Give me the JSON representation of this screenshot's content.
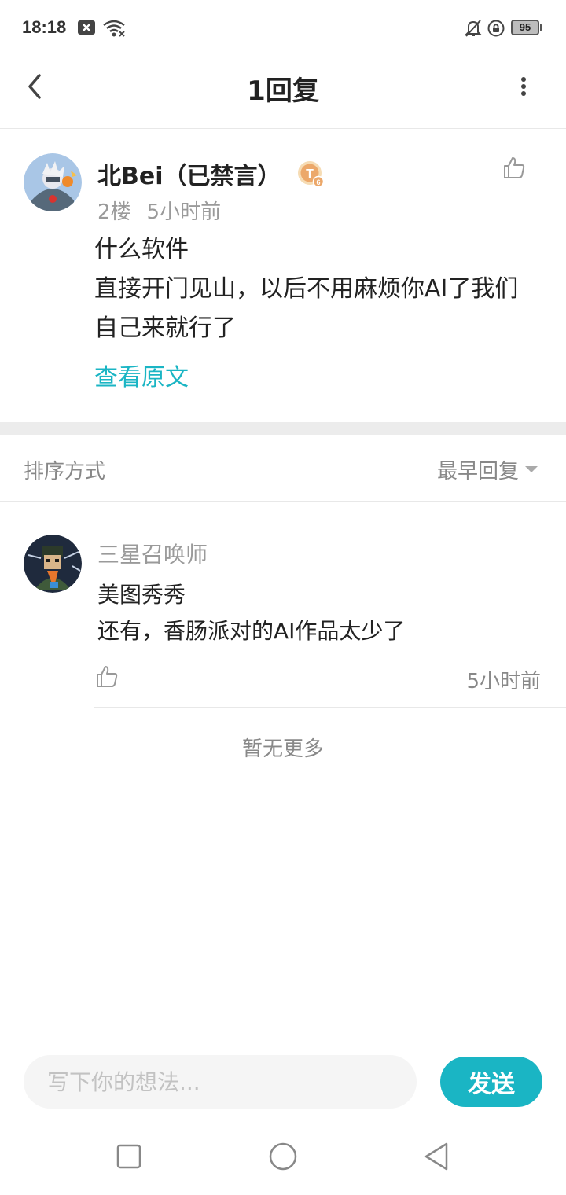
{
  "status_bar": {
    "time": "18:18",
    "battery": "95",
    "icons": [
      "notification-x-icon",
      "wifi-icon",
      "mute-bell-icon",
      "rotation-lock-icon",
      "battery-icon"
    ]
  },
  "nav": {
    "title": "1回复",
    "back_icon": "chevron-left-icon",
    "more_icon": "vertical-ellipsis-icon"
  },
  "post": {
    "author": "北Bei（已禁言）",
    "badge_icon": "level-badge-icon",
    "badge_letter": "T",
    "badge_level": "6",
    "floor": "2楼",
    "time": "5小时前",
    "lines": [
      "什么软件",
      "直接开门见山，以后不用麻烦你AI了我们",
      "自己来就行了"
    ],
    "view_original": "查看原文"
  },
  "sort": {
    "label": "排序方式",
    "value": "最早回复"
  },
  "reply": {
    "author": "三星召唤师",
    "lines": [
      "美图秀秀",
      "还有，香肠派对的AI作品太少了"
    ],
    "time": "5小时前"
  },
  "no_more": "暂无更多",
  "input": {
    "placeholder": "写下你的想法...",
    "send_label": "发送"
  },
  "colors": {
    "accent": "#1ab5c4",
    "muted_text": "#9a9a9a",
    "divider": "#e8e8e8"
  }
}
